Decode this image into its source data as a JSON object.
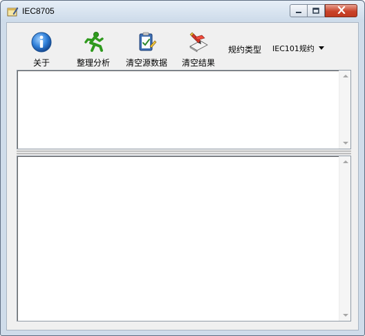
{
  "window": {
    "title": "IEC8705"
  },
  "toolbar": {
    "about_label": "关于",
    "analyze_label": "整理分析",
    "clear_source_label": "清空源数据",
    "clear_result_label": "清空结果"
  },
  "protocol": {
    "label": "规约类型",
    "selected": "IEC101规约"
  },
  "colors": {
    "title_bar": "#cddbea",
    "close_button": "#c9432a",
    "client_bg": "#f0f0f0",
    "pane_bg": "#ffffff"
  },
  "icons": {
    "app": "notepad-icon",
    "about": "info-icon",
    "analyze": "running-man-icon",
    "clear_source": "clipboard-check-icon",
    "clear_result": "eraser-pen-icon"
  }
}
